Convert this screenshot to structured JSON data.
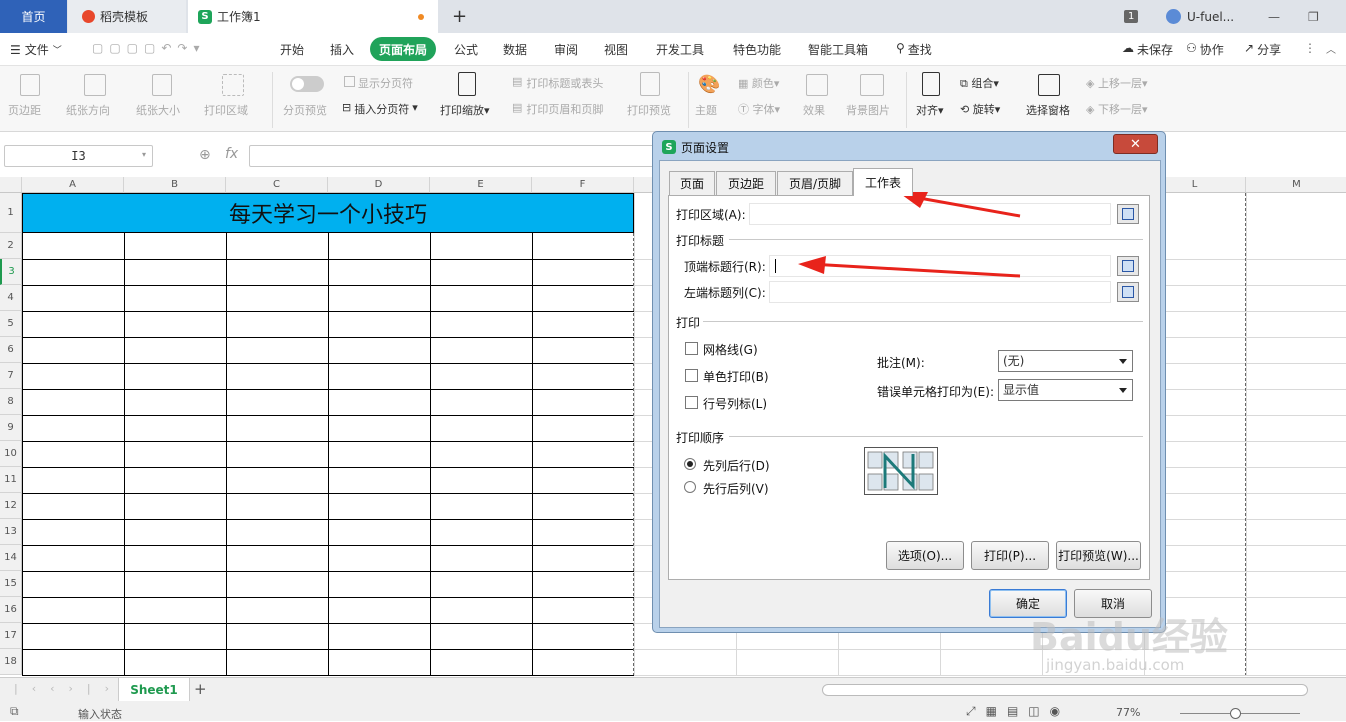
{
  "tabs": {
    "home": "首页",
    "template": "稻壳模板",
    "workbook": "工作簿1",
    "new": "+"
  },
  "titlebar": {
    "badge": "1",
    "user": "U-fuel..."
  },
  "menu": {
    "file": "文件",
    "items": [
      "开始",
      "插入",
      "页面布局",
      "公式",
      "数据",
      "审阅",
      "视图",
      "开发工具",
      "特色功能",
      "智能工具箱"
    ],
    "active": "页面布局",
    "search": "查找",
    "unsaved": "未保存",
    "collab": "协作",
    "share": "分享"
  },
  "ribbon": {
    "margins": "页边距",
    "orientation": "纸张方向",
    "size": "纸张大小",
    "print_area": "打印区域",
    "page_break_preview": "分页预览",
    "show_page_break": "显示分页符",
    "insert_page_break": "插入分页符",
    "print_scale": "打印缩放",
    "print_titles": "打印标题或表头",
    "header_footer": "打印页眉和页脚",
    "print_preview": "打印预览",
    "theme": "主题",
    "colors": "颜色",
    "fonts": "字体",
    "effects": "效果",
    "background": "背景图片",
    "align": "对齐",
    "group": "组合",
    "rotate": "旋转",
    "selection_pane": "选择窗格",
    "bring_forward": "上移一层",
    "send_backward": "下移一层"
  },
  "formula_bar": {
    "name_box": "I3",
    "fx": "fx"
  },
  "grid": {
    "columns": [
      "A",
      "B",
      "C",
      "D",
      "E",
      "F",
      "L",
      "M"
    ],
    "rows": [
      "1",
      "2",
      "3",
      "4",
      "5",
      "6",
      "7",
      "8",
      "9",
      "10",
      "11",
      "12",
      "13",
      "14",
      "15",
      "16",
      "17",
      "18"
    ],
    "title_cell": "每天学习一个小技巧",
    "title_fill": "#00b0ef"
  },
  "sheet_tabs": {
    "active": "Sheet1",
    "add": "+"
  },
  "status": {
    "text": "输入状态",
    "zoom": "77%"
  },
  "dialog": {
    "title": "页面设置",
    "close": "✕",
    "tabs": [
      "页面",
      "页边距",
      "页眉/页脚",
      "工作表"
    ],
    "active_tab": "工作表",
    "print_area_label": "打印区域(A):",
    "print_titles_group": "打印标题",
    "top_rows_label": "顶端标题行(R):",
    "left_cols_label": "左端标题列(C):",
    "print_group": "打印",
    "gridlines": "网格线(G)",
    "black_white": "单色打印(B)",
    "row_col_headers": "行号列标(L)",
    "comments_label": "批注(M):",
    "comments_value": "(无)",
    "errors_label": "错误单元格打印为(E):",
    "errors_value": "显示值",
    "order_group": "打印顺序",
    "down_then_over": "先列后行(D)",
    "over_then_down": "先行后列(V)",
    "options_btn": "选项(O)...",
    "print_btn": "打印(P)...",
    "preview_btn": "打印预览(W)...",
    "ok_btn": "确定",
    "cancel_btn": "取消"
  },
  "watermark": {
    "brand": "Baidu经验",
    "url": "jingyan.baidu.com"
  }
}
